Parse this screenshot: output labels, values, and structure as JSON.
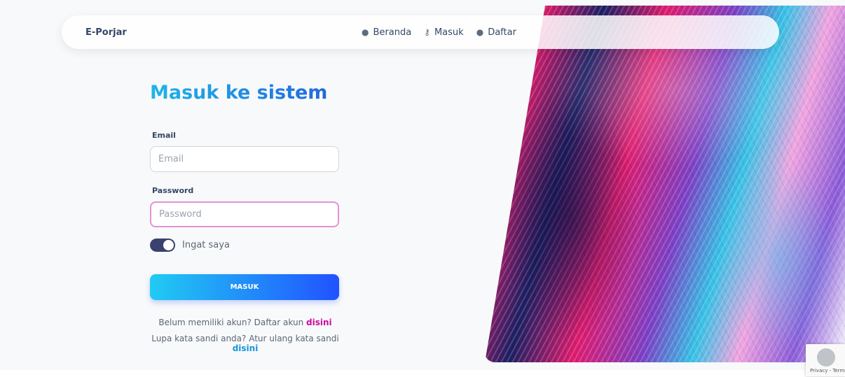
{
  "navbar": {
    "brand": "E-Porjar",
    "links": [
      {
        "label": "Beranda",
        "icon": "user-circle-icon"
      },
      {
        "label": "Masuk",
        "icon": "key-icon"
      },
      {
        "label": "Daftar",
        "icon": "user-circle-icon"
      }
    ]
  },
  "form": {
    "title": "Masuk ke sistem",
    "email_label": "Email",
    "email_placeholder": "Email",
    "password_label": "Password",
    "password_placeholder": "Password",
    "remember_label": "Ingat saya",
    "remember_checked": true,
    "submit_label": "MASUK"
  },
  "footer": {
    "register_text": "Belum memiliki akun? Daftar akun ",
    "register_link": "disini",
    "reset_text": "Lupa kata sandi anda? Atur ulang kata sandi ",
    "reset_link": "disini"
  },
  "recaptcha": {
    "text": "Privacy - Terms"
  },
  "colors": {
    "title_gradient": [
      "#1fb5e8",
      "#2168e0"
    ],
    "button_gradient": [
      "#21cbf3",
      "#2152ff"
    ],
    "link_pink": "#cb0c9f",
    "link_blue": "#1796d8",
    "switch_on": "#3a416f"
  }
}
